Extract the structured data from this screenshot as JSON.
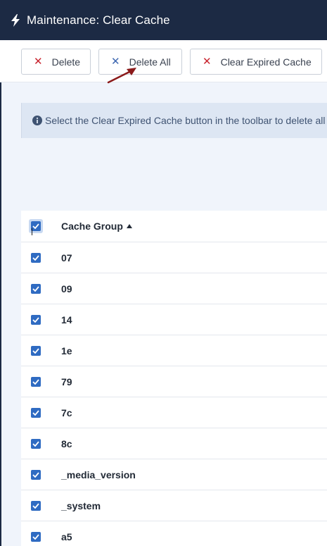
{
  "header": {
    "title": "Maintenance: Clear Cache",
    "icon": "bolt-icon"
  },
  "toolbar": {
    "delete_label": "Delete",
    "delete_all_label": "Delete All",
    "clear_expired_label": "Clear Expired Cache",
    "x_glyph": "✕"
  },
  "alert": {
    "text": "Select the Clear Expired Cache button in the toolbar to delete all expired cache files"
  },
  "table": {
    "header_label": "Cache Group",
    "sort": "ascending",
    "rows": [
      {
        "group": "07"
      },
      {
        "group": "09"
      },
      {
        "group": "14"
      },
      {
        "group": "1e"
      },
      {
        "group": "79"
      },
      {
        "group": "7c"
      },
      {
        "group": "8c"
      },
      {
        "group": "_media_version"
      },
      {
        "group": "_system"
      },
      {
        "group": "a5"
      }
    ]
  },
  "colors": {
    "header_bg": "#1c2a44",
    "accent": "#2f6bc2",
    "danger": "#c8242e",
    "annotation_arrow": "#8b1a1a"
  }
}
